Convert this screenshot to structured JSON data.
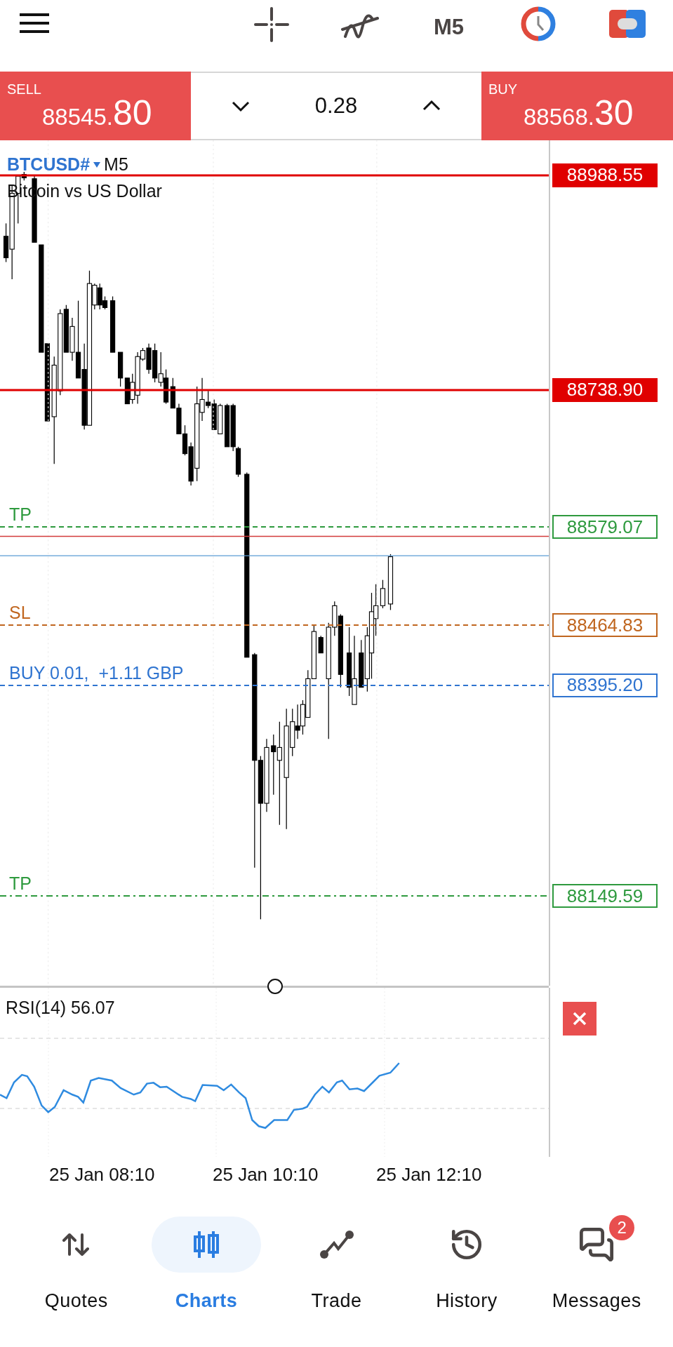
{
  "toolbar": {
    "timeframe": "M5"
  },
  "quote_bar": {
    "sell": {
      "label": "SELL",
      "price": "88545.80"
    },
    "spread": "0.28",
    "buy": {
      "label": "BUY",
      "price": "88568.30"
    }
  },
  "chart": {
    "symbol": "BTCUSD#",
    "timeframe": "M5",
    "description": "Bitcoin vs US Dollar",
    "levels": [
      {
        "kind": "alert",
        "price": "88988.55",
        "color": "#e00000"
      },
      {
        "kind": "alert",
        "price": "88738.90",
        "color": "#e00000"
      },
      {
        "kind": "order",
        "label": "TP",
        "price": "88579.07",
        "color": "#2e9a3e",
        "dash_dot": false
      },
      {
        "kind": "order",
        "label": "SL",
        "price": "88464.83",
        "color": "#c0661f",
        "dash_dot": false
      },
      {
        "kind": "order",
        "label": "BUY 0.01,  +1.11 GBP",
        "price": "88395.20",
        "color": "#2f74d0",
        "dash_dot": false
      },
      {
        "kind": "order",
        "label": "TP",
        "price": "88149.59",
        "color": "#2e9a3e",
        "dash_dot": true
      }
    ],
    "indicator": {
      "name": "RSI(14) 56.07"
    },
    "time_labels": [
      "25 Jan 08:10",
      "25 Jan 10:10",
      "25 Jan 12:10"
    ]
  },
  "nav": [
    {
      "label": "Quotes",
      "selected": false
    },
    {
      "label": "Charts",
      "selected": true
    },
    {
      "label": "Trade",
      "selected": false
    },
    {
      "label": "History",
      "selected": false
    },
    {
      "label": "Messages",
      "selected": false,
      "badge": "2"
    }
  ]
}
